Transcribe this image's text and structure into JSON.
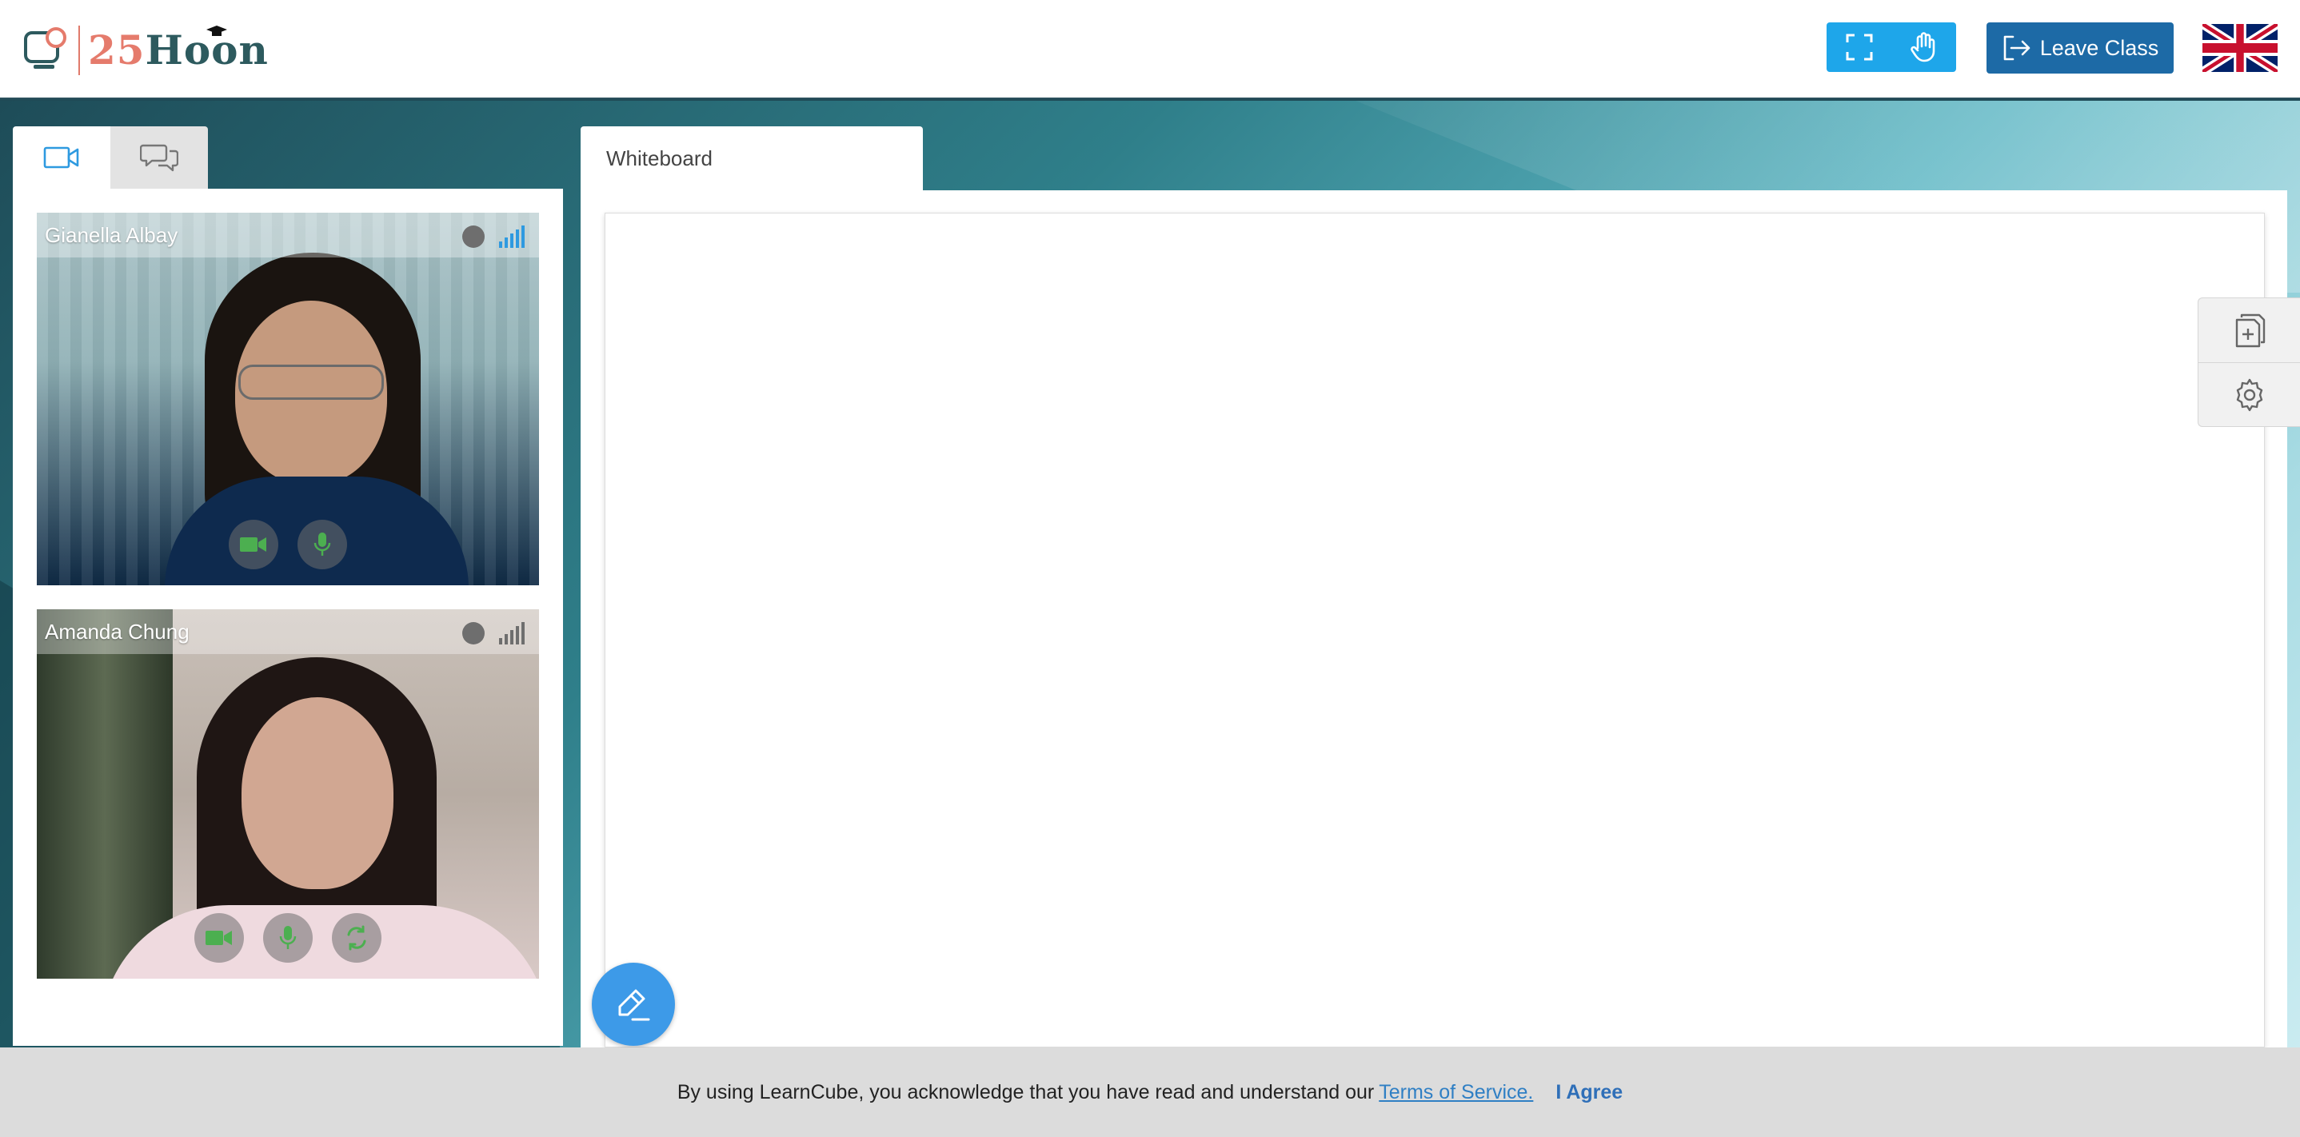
{
  "header": {
    "logo_number": "25",
    "logo_word": "Hoon",
    "tools": [
      {
        "icon": "fullscreen-icon"
      },
      {
        "icon": "raise-hand-icon"
      }
    ],
    "leave_label": "Leave Class",
    "language_icon": "uk-flag-icon"
  },
  "left_panel": {
    "tabs": [
      {
        "icon": "video-camera-icon",
        "active": true
      },
      {
        "icon": "chat-icon",
        "active": false
      }
    ],
    "participants": [
      {
        "name": "Gianella Albay",
        "signal_color": "#2e9ae0"
      },
      {
        "name": "Amanda Chung",
        "signal_color": "#6e6e6e"
      }
    ]
  },
  "whiteboard": {
    "tab_label": "Whiteboard"
  },
  "side_tools": [
    {
      "icon": "add-document-icon"
    },
    {
      "icon": "gear-icon"
    }
  ],
  "tos": {
    "text": "By using LearnCube, you acknowledge that you have read and understand our",
    "link": "Terms of Service.",
    "agree": "I Agree"
  },
  "colors": {
    "accent": "#1ea6ea",
    "leave": "#1d6aa6",
    "control_green": "#4caf50",
    "fab": "#3d9ae8"
  }
}
